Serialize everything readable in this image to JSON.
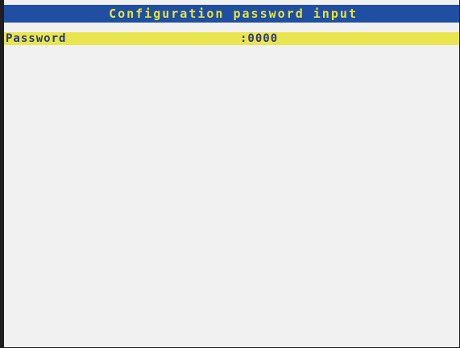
{
  "window": {
    "title": "Configuration password input"
  },
  "password_field": {
    "label": "Password",
    "value": ":0000"
  },
  "colors": {
    "title_bar_bg": "#1f4fa3",
    "title_text": "#e9e33a",
    "selected_row_bg": "#e9e54f",
    "row_text": "#2a3a7a",
    "screen_bg": "#f1f1f1"
  }
}
